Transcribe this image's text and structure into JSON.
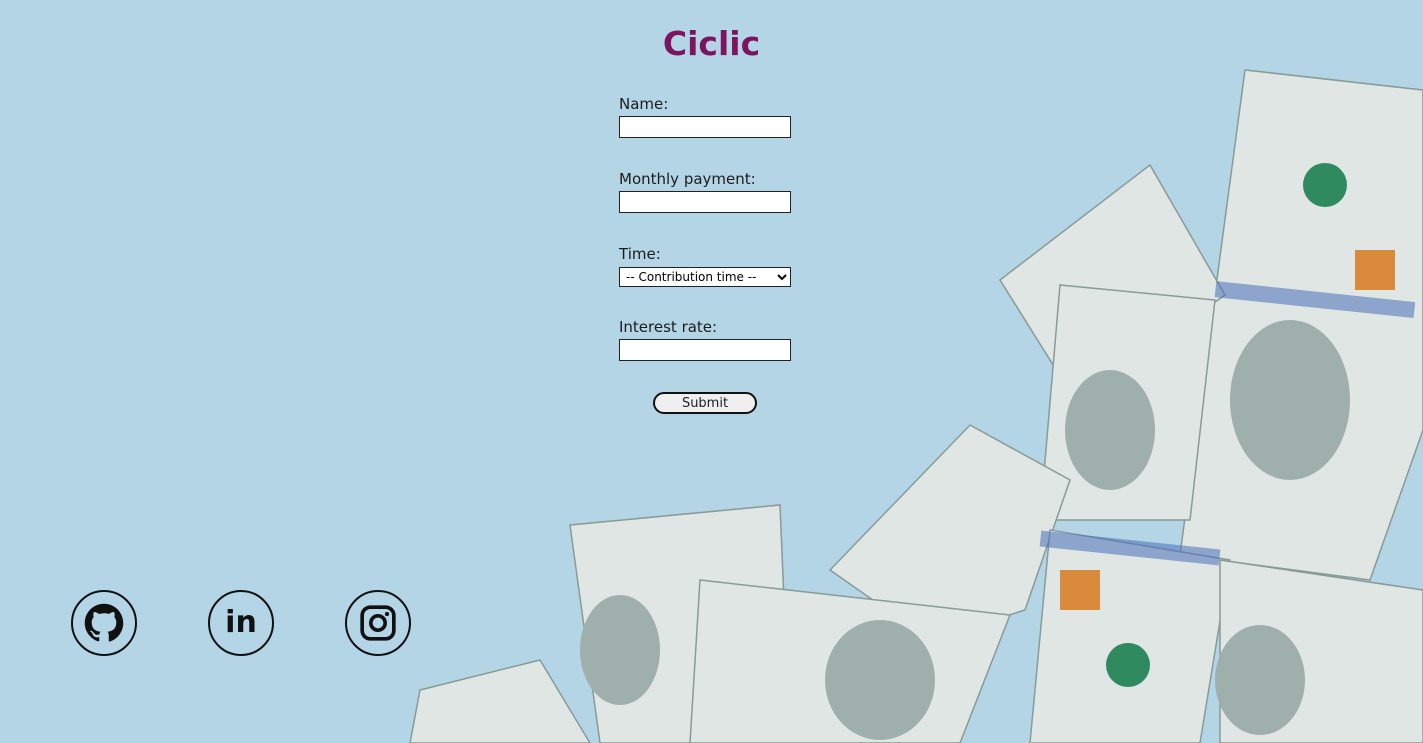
{
  "app": {
    "title": "Ciclic"
  },
  "form": {
    "name_label": "Name:",
    "name_value": "",
    "monthly_label": "Monthly payment:",
    "monthly_value": "",
    "time_label": "Time:",
    "time_selected": "-- Contribution time --",
    "interest_label": "Interest rate:",
    "interest_value": "",
    "submit_label": "Submit"
  },
  "social": [
    {
      "name": "github",
      "icon": "github-icon"
    },
    {
      "name": "linkedin",
      "icon": "linkedin-icon",
      "text": "in"
    },
    {
      "name": "instagram",
      "icon": "instagram-icon"
    }
  ],
  "colors": {
    "background": "#b3d5e6",
    "title": "#7d1460",
    "banknote": "#dfe6e4"
  }
}
